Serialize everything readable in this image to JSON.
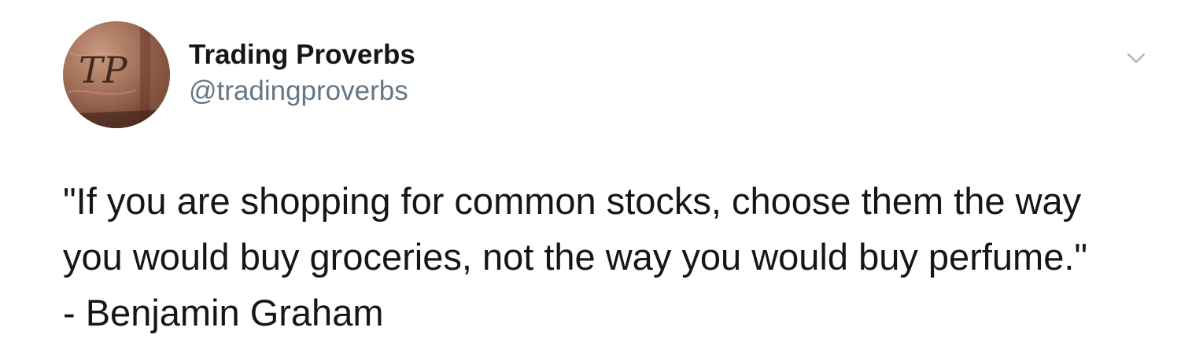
{
  "author": {
    "name": "Trading Proverbs",
    "handle": "@tradingproverbs",
    "avatar_monogram": "TP"
  },
  "tweet": {
    "lines": [
      "\"If you are shopping for common stocks, choose them the way",
      "you would buy groceries, not the way you would buy perfume.\"",
      "- Benjamin Graham"
    ]
  },
  "icons": {
    "menu": "chevron-down-icon"
  },
  "colors": {
    "name_text": "#14171a",
    "handle_text": "#657786",
    "chevron": "#aab8c2",
    "avatar_tint": "#a8745e"
  }
}
